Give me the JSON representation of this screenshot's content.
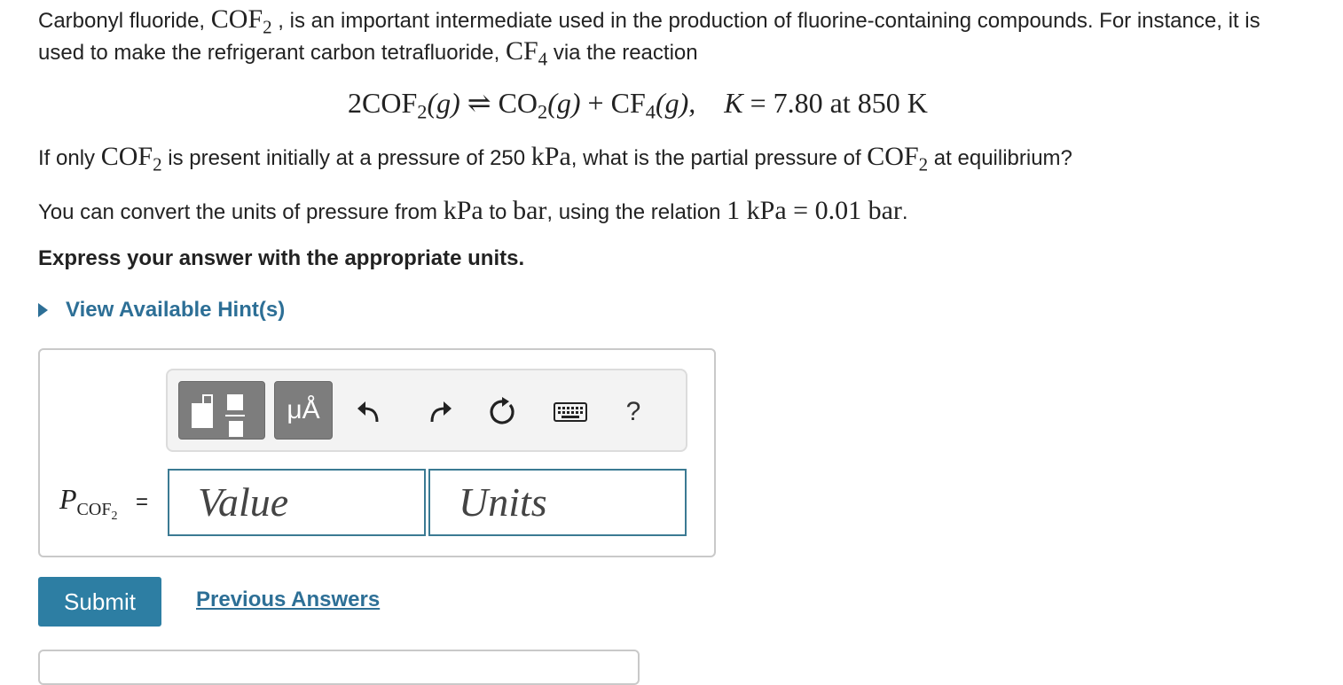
{
  "intro": {
    "p1": "Carbonyl fluoride, ",
    "chem1": "COF",
    "chem1_sub": "2",
    "p2": " , is an important intermediate used in the production of fluorine-containing compounds. For instance, it is used to make the refrigerant carbon tetrafluoride, ",
    "chem2": "CF",
    "chem2_sub": "4",
    "p3": " via the reaction"
  },
  "reaction": {
    "coef": "2",
    "r1": "COF",
    "r1_sub": "2",
    "phase1": "(g)",
    "arrow": "⇌",
    "p1": "CO",
    "p1_sub": "2",
    "phase2": "(g)",
    "plus": "+",
    "p2": "CF",
    "p2_sub": "4",
    "phase3": "(g),",
    "k_symbol": "K",
    "k_eq": " = 7.80 at 850 K"
  },
  "question": {
    "t1": "If only ",
    "chem": "COF",
    "chem_sub": "2",
    "t2": " is present initially at a pressure of 250 ",
    "unit": "kPa",
    "t3": ", what is the partial pressure of ",
    "chem2": "COF",
    "chem2_sub": "2",
    "t4": " at equilibrium?"
  },
  "convert": {
    "t1": "You can convert the units of pressure from ",
    "u1": "kPa",
    "t2": " to ",
    "u2": "bar",
    "t3": ", using the relation ",
    "rel": "1 kPa = 0.01 bar",
    "t4": "."
  },
  "express": "Express your answer with the appropriate units.",
  "hints_label": "View Available Hint(s)",
  "toolbar": {
    "units_label": "μÅ",
    "help_label": "?"
  },
  "answer": {
    "var": "P",
    "var_sub": "COF",
    "var_sub2": "2",
    "equals": "=",
    "value_placeholder": "Value",
    "units_placeholder": "Units"
  },
  "submit_label": "Submit",
  "previous_answers_label": "Previous Answers"
}
